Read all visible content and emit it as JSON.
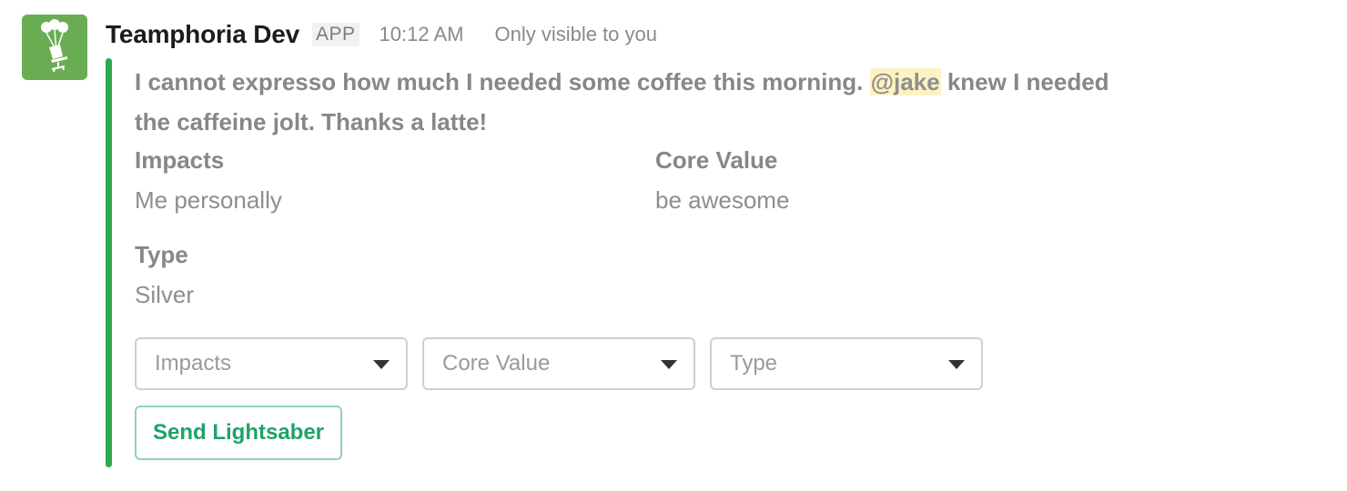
{
  "message": {
    "sender": "Teamphoria Dev",
    "app_badge": "APP",
    "time": "10:12 AM",
    "visibility": "Only visible to you",
    "avatar_icon": "balloons-chair-icon",
    "accent_color": "#2eaa4f",
    "body": {
      "line1_before": "I cannot expresso how much I needed some coffee this morning.",
      "mention": "@jake",
      "line1_after": "knew I needed",
      "line2": "the caffeine jolt. Thanks a latte!"
    },
    "fields": [
      {
        "title": "Impacts",
        "value": "Me personally"
      },
      {
        "title": "Core Value",
        "value": "be awesome"
      },
      {
        "title": "Type",
        "value": "Silver"
      }
    ],
    "selects": [
      {
        "placeholder": "Impacts"
      },
      {
        "placeholder": "Core Value"
      },
      {
        "placeholder": "Type"
      }
    ],
    "button_label": "Send Lightsaber"
  }
}
